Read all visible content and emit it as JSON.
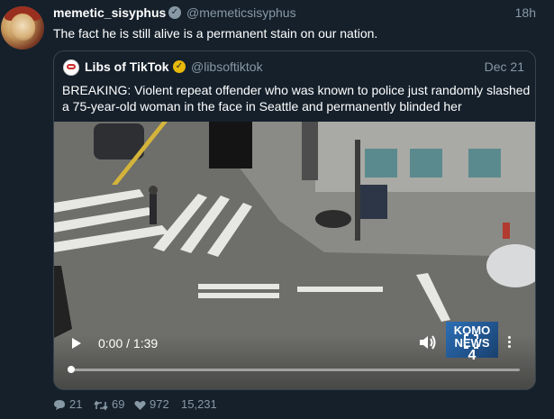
{
  "tweet": {
    "author_name": "memetic_sisyphus",
    "author_handle": "@memeticsisyphus",
    "time": "18h",
    "text": "The fact he is still alive is a permanent stain on our nation."
  },
  "quoted": {
    "author_name": "Libs of TikTok",
    "author_handle": "@libsoftiktok",
    "time": "Dec 21",
    "text": "BREAKING: Violent repeat offender who was known to police just randomly slashed a 75-year-old woman in the face in Seattle and permanently blinded her"
  },
  "video": {
    "time_display": "0:00 / 1:39",
    "progress": 0,
    "watermark_brand": "KOMO",
    "watermark_word": "NEWS",
    "watermark_channel": "4"
  },
  "actions": {
    "replies": "21",
    "retweets": "69",
    "likes": "972",
    "views": "15,231"
  },
  "icons": {
    "reply": "reply-icon",
    "retweet": "retweet-icon",
    "like": "heart-icon",
    "views": "views-icon"
  },
  "colors": {
    "background": "#15202b",
    "secondary_text": "#8899a6",
    "quoted_verified": "#e8b80b"
  }
}
